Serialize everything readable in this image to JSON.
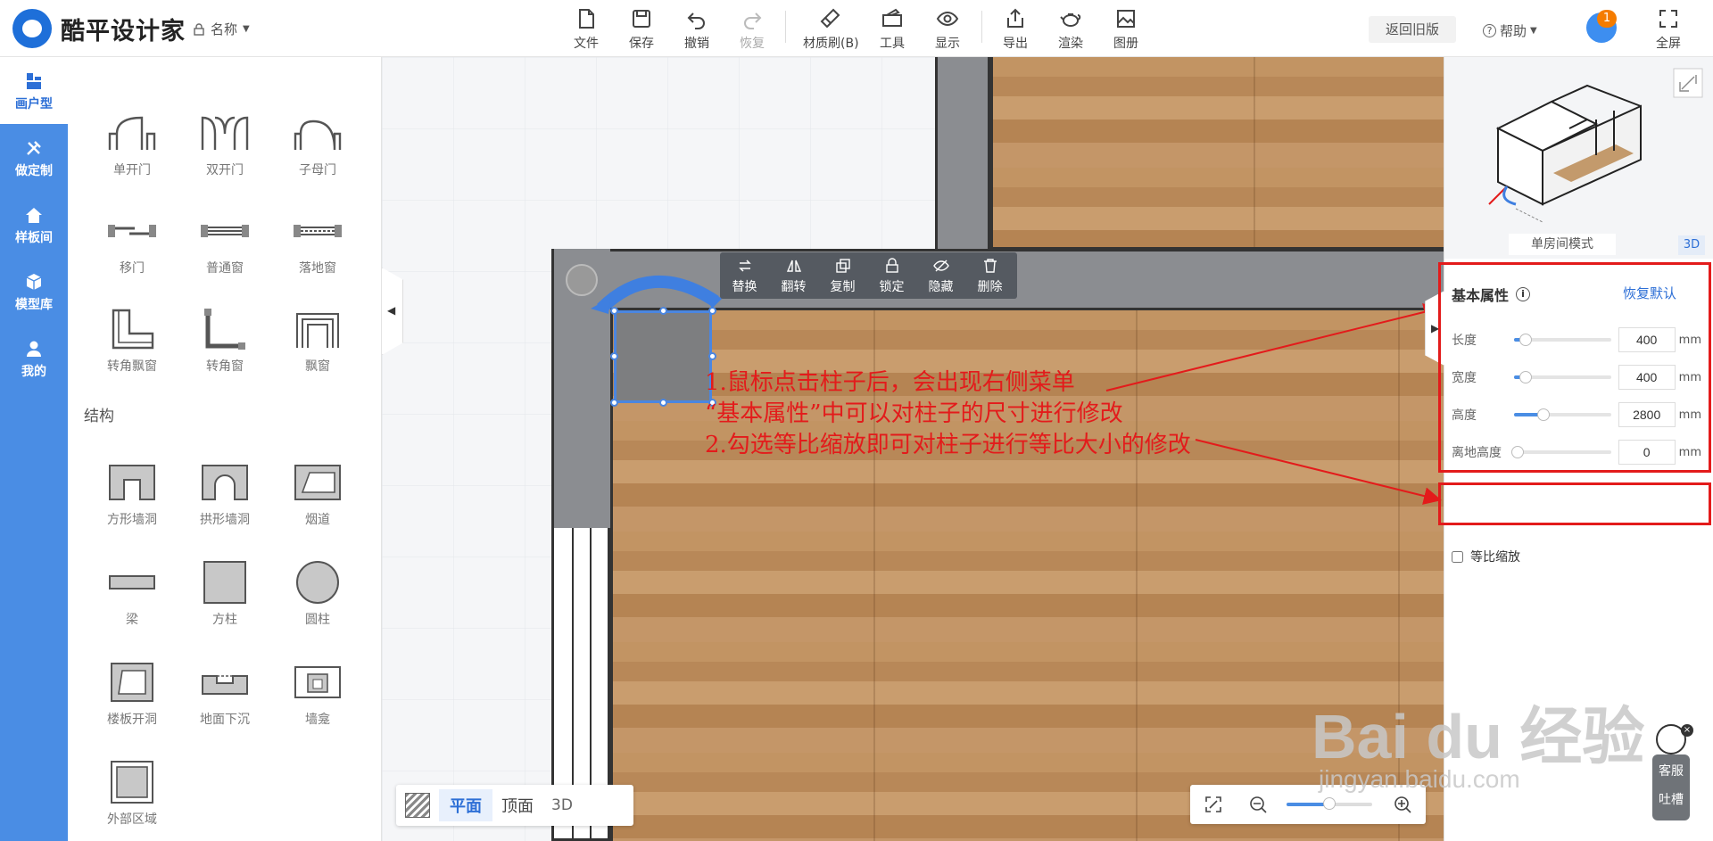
{
  "app": {
    "logo_text": "酷平设计家",
    "project_name": "名称"
  },
  "toolbar": {
    "file": "文件",
    "save": "保存",
    "undo": "撤销",
    "redo": "恢复",
    "material_brush": "材质刷(B)",
    "tools": "工具",
    "display": "显示",
    "export": "导出",
    "render": "渲染",
    "album": "图册",
    "old_version": "返回旧版",
    "help": "帮助",
    "notification_count": "1",
    "fullscreen": "全屏"
  },
  "nav": {
    "items": [
      {
        "label": "画户型"
      },
      {
        "label": "做定制"
      },
      {
        "label": "样板间"
      },
      {
        "label": "模型库"
      },
      {
        "label": "我的"
      }
    ]
  },
  "palette": {
    "doors_windows": [
      "单开门",
      "双开门",
      "子母门",
      "移门",
      "普通窗",
      "落地窗",
      "转角飘窗",
      "转角窗",
      "飘窗"
    ],
    "structure_title": "结构",
    "structure": [
      "方形墙洞",
      "拱形墙洞",
      "烟道",
      "梁",
      "方柱",
      "圆柱",
      "楼板开洞",
      "地面下沉",
      "墙龛",
      "外部区域"
    ]
  },
  "context_toolbar": [
    "替换",
    "翻转",
    "复制",
    "锁定",
    "隐藏",
    "删除"
  ],
  "annotation": {
    "line1": "1.鼠标点击柱子后，会出现右侧菜单",
    "line2": "“基本属性”中可以对柱子的尺寸进行修改",
    "line3": "2.勾选等比缩放即可对柱子进行等比大小的修改"
  },
  "view_modes": {
    "plan": "平面",
    "top": "顶面",
    "three_d": "3D",
    "active": "平面"
  },
  "zoom": {
    "level": 0.5
  },
  "preview": {
    "mode_label": "单房间模式",
    "badge": "3D"
  },
  "properties": {
    "title": "基本属性",
    "reset": "恢复默认",
    "unit": "mm",
    "fields": [
      {
        "label": "长度",
        "value": "400",
        "fraction": 0.12
      },
      {
        "label": "宽度",
        "value": "400",
        "fraction": 0.12
      },
      {
        "label": "高度",
        "value": "2800",
        "fraction": 0.3
      },
      {
        "label": "离地高度",
        "value": "0",
        "fraction": 0.0
      }
    ],
    "proportional_label": "等比缩放",
    "proportional_checked": false
  },
  "float_service": {
    "line1": "客服",
    "line2": "吐槽"
  },
  "watermark": {
    "main": "Bai du 经验",
    "sub": "jingyan.baidu.com"
  },
  "colors": {
    "primary": "#4a8de4",
    "annotation": "#e31b1b"
  }
}
